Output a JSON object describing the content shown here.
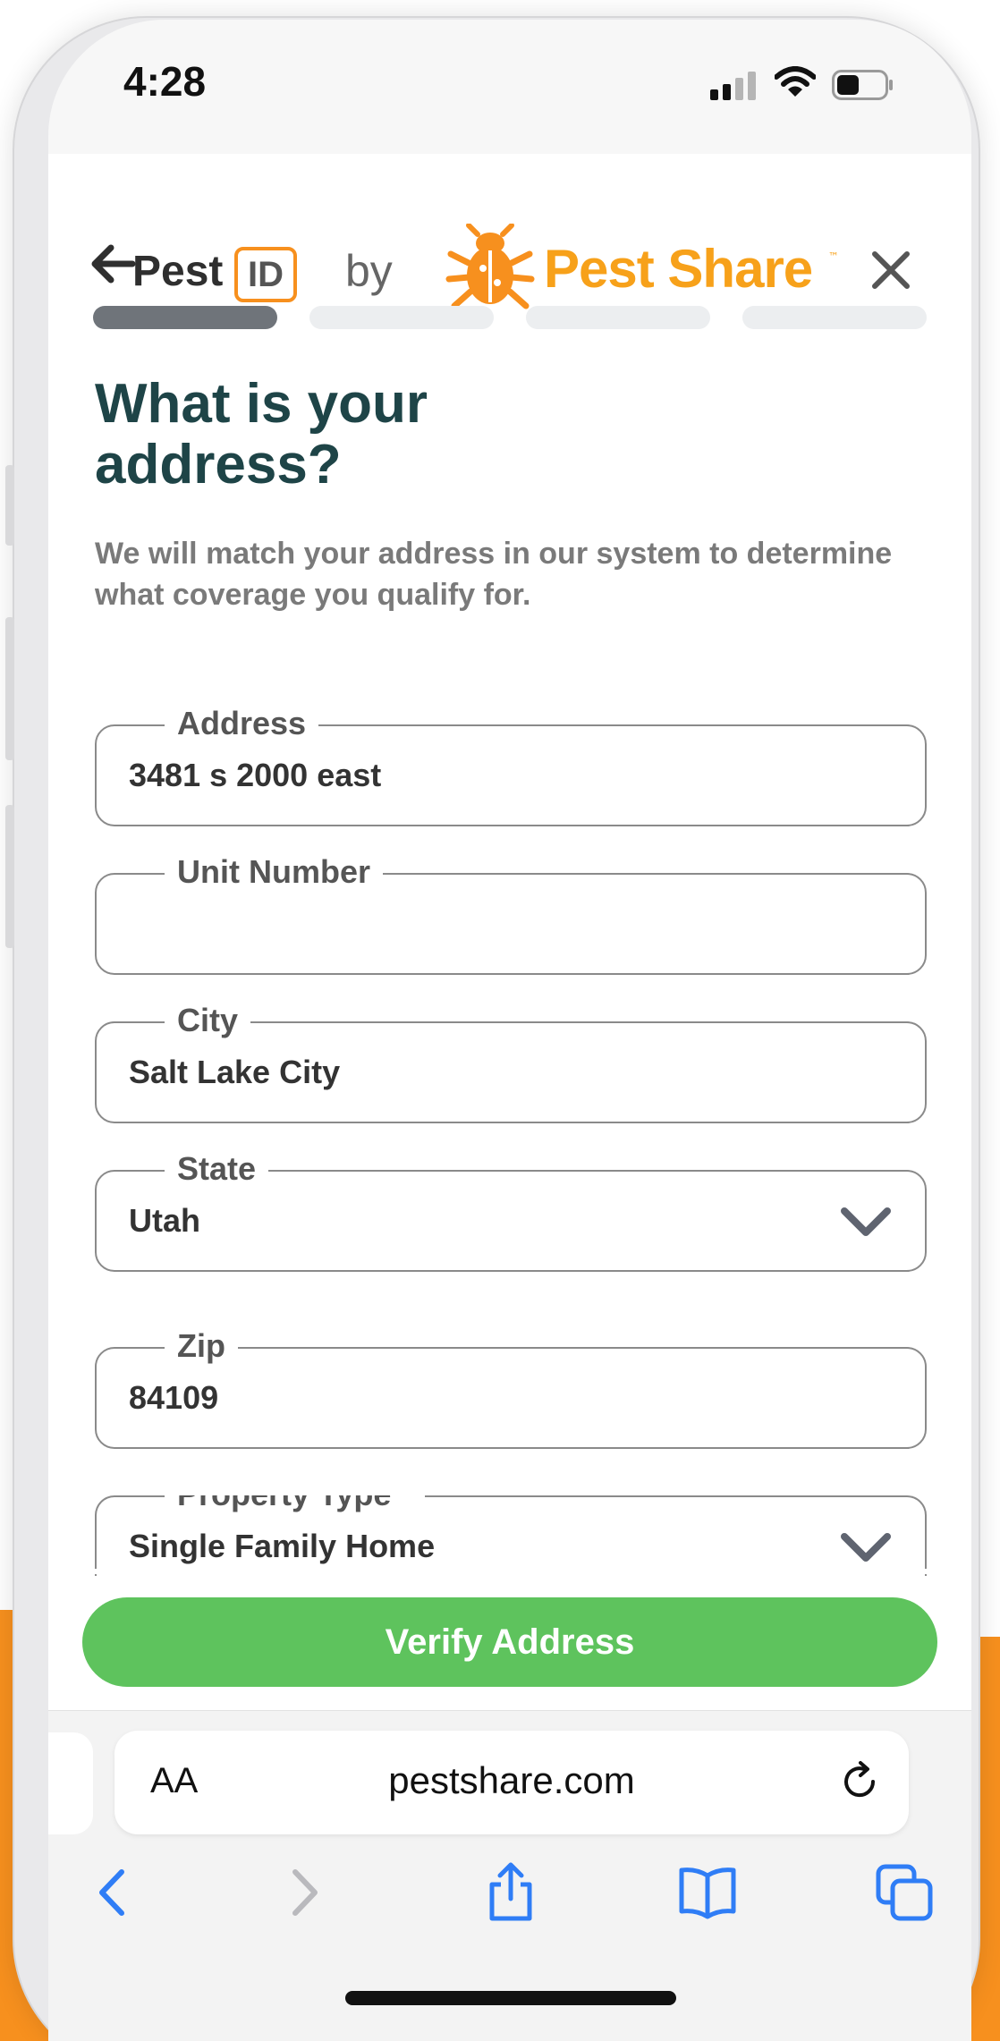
{
  "status_bar": {
    "time": "4:28"
  },
  "header": {
    "brand_left_word": "Pest",
    "brand_left_box": "ID",
    "by": "by",
    "brand_name": "Pest Share",
    "trademark": "™"
  },
  "progress": {
    "total_steps": 4,
    "current_step": 1
  },
  "page": {
    "title": "What is your address?",
    "subtitle": "We will match your address in our system to determine what coverage you qualify for."
  },
  "form": {
    "address": {
      "label": "Address",
      "value": "3481 s 2000 east"
    },
    "unit": {
      "label": "Unit Number",
      "value": ""
    },
    "city": {
      "label": "City",
      "value": "Salt Lake City"
    },
    "state": {
      "label": "State",
      "value": "Utah"
    },
    "zip": {
      "label": "Zip",
      "value": "84109"
    },
    "property_type": {
      "label": "Property Type *",
      "value": "Single Family Home"
    }
  },
  "actions": {
    "verify_label": "Verify Address"
  },
  "browser": {
    "aa_label": "AA",
    "url": "pestshare.com"
  },
  "icons": {
    "back": "arrow-left-icon",
    "close": "close-icon",
    "logo": "beetle-logo-icon",
    "dropdown": "chevron-down-icon",
    "reload": "reload-icon",
    "nav_back": "chevron-left-icon",
    "nav_forward": "chevron-right-icon",
    "share": "share-icon",
    "bookmarks": "book-icon",
    "tabs": "tabs-icon"
  },
  "colors": {
    "brand_orange": "#f7901e",
    "title_teal": "#1e4447",
    "verify_green": "#5ec35d",
    "ios_blue": "#2f7df6"
  }
}
